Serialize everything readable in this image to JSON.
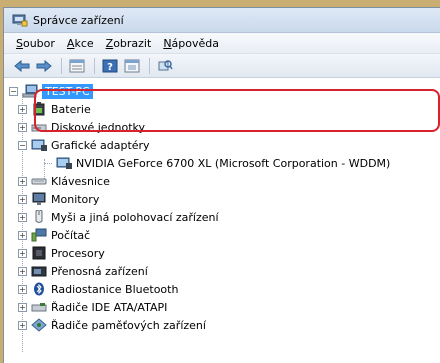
{
  "window": {
    "title": "Správce zařízení"
  },
  "menu": [
    {
      "label": "Soubor",
      "mn": "S",
      "rest": "oubor"
    },
    {
      "label": "Akce",
      "mn": "A",
      "rest": "kce"
    },
    {
      "label": "Zobrazit",
      "mn": "Z",
      "rest": "obrazit"
    },
    {
      "label": "Nápověda",
      "mn": "N",
      "rest": "ápověda"
    }
  ],
  "tree": {
    "root": "TEST-PC",
    "categories": [
      {
        "label": "Baterie",
        "icon": "battery-icon",
        "expanded": false
      },
      {
        "label": "Diskové jednotky",
        "icon": "disk-drive-icon",
        "expanded": false
      },
      {
        "label": "Grafické adaptéry",
        "icon": "display-adapter-icon",
        "expanded": true,
        "children": [
          {
            "label": "NVIDIA GeForce 6700 XL (Microsoft Corporation - WDDM)",
            "icon": "display-adapter-icon"
          }
        ]
      },
      {
        "label": "Klávesnice",
        "icon": "keyboard-icon",
        "expanded": false
      },
      {
        "label": "Monitory",
        "icon": "monitor-icon",
        "expanded": false
      },
      {
        "label": "Myši a jiná polohovací zařízení",
        "icon": "mouse-icon",
        "expanded": false
      },
      {
        "label": "Počítač",
        "icon": "computer-icon",
        "expanded": false
      },
      {
        "label": "Procesory",
        "icon": "processor-icon",
        "expanded": false
      },
      {
        "label": "Přenosná zařízení",
        "icon": "portable-device-icon",
        "expanded": false
      },
      {
        "label": "Radiostanice Bluetooth",
        "icon": "bluetooth-icon",
        "expanded": false
      },
      {
        "label": "Řadiče IDE ATA/ATAPI",
        "icon": "ide-controller-icon",
        "expanded": false
      },
      {
        "label": "Řadiče paměťových zařízení",
        "icon": "storage-controller-icon",
        "expanded": false
      }
    ]
  },
  "colors": {
    "highlight_border": "#d8222b",
    "selection": "#3399ff",
    "background": "#c9ad71"
  }
}
